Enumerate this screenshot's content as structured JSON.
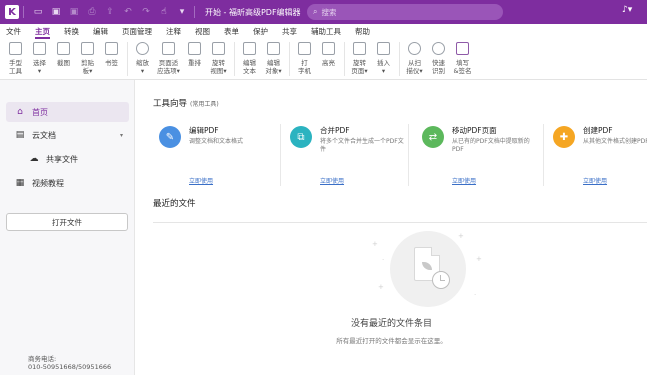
{
  "titlebar": {
    "app_title": "开始 - 福昕高级PDF编辑器",
    "search_placeholder": "搜索",
    "logo_glyph": "K",
    "icons": [
      "folder-open-icon",
      "save-icon",
      "save-as-icon",
      "print-icon",
      "share-icon",
      "undo-icon",
      "redo-icon",
      "hand-tool-icon",
      "more-icon"
    ]
  },
  "menubar": {
    "items": [
      "文件",
      "主页",
      "转换",
      "编辑",
      "页面管理",
      "注释",
      "视图",
      "表单",
      "保护",
      "共享",
      "辅助工具",
      "帮助"
    ],
    "active_index": 1
  },
  "ribbon": {
    "buttons": [
      {
        "label": "手型\n工具",
        "icon": "hand-icon"
      },
      {
        "label": "选择\n▾",
        "icon": "select-icon"
      },
      {
        "label": "截图",
        "icon": "snapshot-icon"
      },
      {
        "label": "剪贴\n板▾",
        "icon": "clipboard-icon"
      },
      {
        "label": "书签",
        "icon": "bookmark-icon"
      },
      {
        "label": "缩放\n▾",
        "icon": "zoom-icon"
      },
      {
        "label": "页面适\n应选项▾",
        "icon": "fit-page-icon"
      },
      {
        "label": "重排",
        "icon": "reflow-icon"
      },
      {
        "label": "旋转\n视图▾",
        "icon": "rotate-view-icon"
      },
      {
        "label": "编辑\n文本",
        "icon": "edit-text-icon"
      },
      {
        "label": "编辑\n对象▾",
        "icon": "edit-object-icon"
      },
      {
        "label": "打\n字机",
        "icon": "typewriter-icon"
      },
      {
        "label": "高亮",
        "icon": "highlight-icon"
      },
      {
        "label": "旋转\n页面▾",
        "icon": "rotate-page-icon"
      },
      {
        "label": "插入\n▾",
        "icon": "insert-icon"
      },
      {
        "label": "从扫\n描仪▾",
        "icon": "scanner-icon"
      },
      {
        "label": "快速\n识别",
        "icon": "quick-ocr-icon"
      },
      {
        "label": "填写\n&签名",
        "icon": "fill-sign-icon"
      }
    ]
  },
  "sidebar": {
    "items": [
      {
        "label": "首页",
        "icon": "home-icon"
      },
      {
        "label": "云文档",
        "icon": "cloud-doc-icon"
      },
      {
        "label": "共享文件",
        "icon": "cloud-share-icon"
      },
      {
        "label": "视频教程",
        "icon": "video-icon"
      }
    ],
    "open_file_label": "打开文件",
    "contact_label": "商务电话:",
    "contact_phone": "010-50951668/50951666"
  },
  "main": {
    "tools_title": "工具向导",
    "tools_subtitle": "(常用工具)",
    "cards": [
      {
        "title": "编辑PDF",
        "desc": "调整文档和文本格式",
        "link": "立即使用",
        "icon": "edit-pdf-icon",
        "color": "#4a90e2"
      },
      {
        "title": "合并PDF",
        "desc": "将多个文件合并生成一个PDF文件",
        "link": "立即使用",
        "icon": "merge-pdf-icon",
        "color": "#2bb3c0"
      },
      {
        "title": "移动PDF页面",
        "desc": "从已有的PDF文档中提取新的PDF",
        "link": "立即使用",
        "icon": "move-pages-icon",
        "color": "#5cb85c"
      },
      {
        "title": "创建PDF",
        "desc": "从其他文件格式创建PDF",
        "link": "立即使用",
        "icon": "create-pdf-icon",
        "color": "#f5a623"
      }
    ],
    "recent_title": "最近的文件",
    "empty_title": "没有最近的文件条目",
    "empty_sub": "所有最近打开的文件都会显示在这里。"
  }
}
